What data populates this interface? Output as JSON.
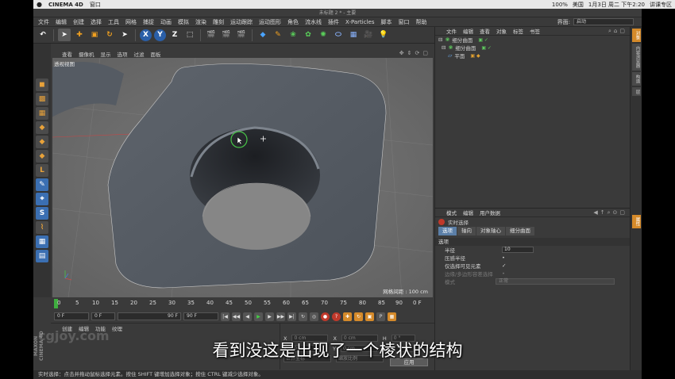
{
  "mac_menubar": {
    "app_name": "CINEMA 4D",
    "menu": "窗口",
    "status_items": [
      "100%",
      "美国",
      "1月3日 周二 下午2:20",
      "讲课专区"
    ]
  },
  "window_title": "未标题 2 * - 主要",
  "main_menu": [
    "文件",
    "编辑",
    "创建",
    "选择",
    "工具",
    "网格",
    "捕捉",
    "动画",
    "模拟",
    "渲染",
    "雕刻",
    "运动跟踪",
    "运动图形",
    "角色",
    "流水线",
    "插件",
    "X-Particles",
    "脚本",
    "窗口",
    "帮助"
  ],
  "layout_label": "界面:",
  "layout_value": "启动",
  "toolbar": {
    "undo": "↶",
    "coord_x": "X",
    "coord_y": "Y",
    "coord_z": "Z"
  },
  "viewport": {
    "menu": [
      "查看",
      "摄像机",
      "显示",
      "选项",
      "过滤",
      "面板"
    ],
    "label": "透视视图",
    "grid_info": "网格间距 : 100 cm"
  },
  "timeline": {
    "ticks": [
      "0",
      "5",
      "10",
      "15",
      "20",
      "25",
      "30",
      "35",
      "40",
      "45",
      "50",
      "55",
      "60",
      "65",
      "70",
      "75",
      "80",
      "85",
      "90"
    ],
    "end_label": "0 F"
  },
  "transport": {
    "start": "0 F",
    "current": "0 F",
    "end": "90 F",
    "max": "90 F"
  },
  "material_manager": {
    "menu": [
      "创建",
      "编辑",
      "功能",
      "纹理"
    ]
  },
  "coordinates": {
    "rows": [
      {
        "axis1": "X",
        "val1": "0 cm",
        "axis2": "X",
        "val2": "0 cm",
        "axis3": "H",
        "val3": "0 °"
      },
      {
        "axis1": "Y",
        "val1": "0 cm",
        "axis2": "Y",
        "val2": "0 cm",
        "axis3": "P",
        "val3": "0 °"
      }
    ],
    "mode1": "世界坐标",
    "mode2": "缩放比例",
    "apply": "应用"
  },
  "object_manager": {
    "menu": [
      "文件",
      "编辑",
      "查看",
      "对象",
      "标签",
      "书签"
    ],
    "objects": [
      {
        "name": "细分曲面",
        "tag": "▣ ✓"
      },
      {
        "name": "细分曲面",
        "tag": "▣ ✓"
      },
      {
        "name": "平面",
        "tag": "▣ ◆"
      }
    ]
  },
  "attribute_manager": {
    "menu": [
      "模式",
      "编辑",
      "用户数据"
    ],
    "tool_name": "实时选择",
    "tabs": [
      "选项",
      "轴向",
      "对象轴心",
      "细分曲面"
    ],
    "section": "选项",
    "radius_label": "半径",
    "radius_value": "10",
    "pressure_label": "压感半径",
    "visible_only_label": "仅选择可见元素",
    "visible_only_check": "✓",
    "edge_label": "边缘/多边形容差选择",
    "mode_label": "模式",
    "mode_value": "正常"
  },
  "right_strip_tabs": [
    "对象",
    "内容浏览器",
    "构造",
    "层"
  ],
  "right_strip_attr_tab": "属性",
  "status_bar": "实时选择：点击并拖动鼠标选择元素。按住 SHIFT 键增加选择对象；按住 CTRL 键减少选择对象。",
  "maxon_label": "MAXON CINEMA 4D",
  "watermark": "cgjoy.com",
  "subtitle": "看到没这是出现了一个棱状的结构"
}
